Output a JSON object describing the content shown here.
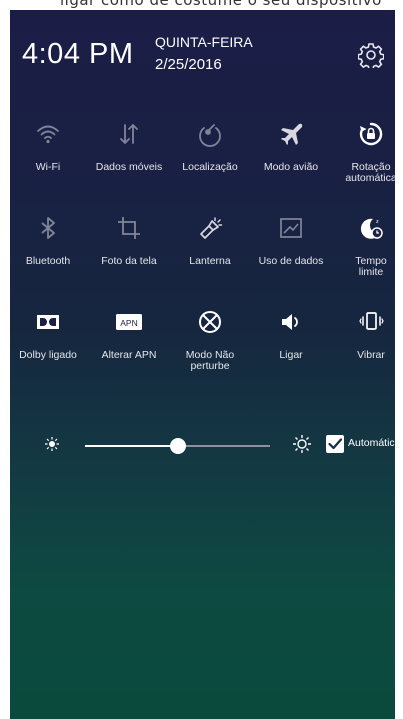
{
  "top_peek_text": "ligar como de costume o seu dispositivo",
  "status": {
    "time": "4:04 PM",
    "day": "QUINTA-FEIRA",
    "date": "2/25/2016"
  },
  "icons": {
    "settings": "gear-icon",
    "brightness_low": "sun-small-icon",
    "brightness_high": "sun-large-icon"
  },
  "tiles": [
    {
      "label": "Wi-Fi",
      "icon": "wifi-icon",
      "enabled": false
    },
    {
      "label": "Dados móveis",
      "icon": "mobile-data-icon",
      "enabled": false
    },
    {
      "label": "Localização",
      "icon": "location-icon",
      "enabled": false
    },
    {
      "label": "Modo avião",
      "icon": "airplane-icon",
      "enabled": false
    },
    {
      "label": "Rotação\nautomática",
      "icon": "rotation-lock-icon",
      "enabled": true
    },
    {
      "label": "Bluetooth",
      "icon": "bluetooth-icon",
      "enabled": false
    },
    {
      "label": "Foto da tela",
      "icon": "crop-icon",
      "enabled": false
    },
    {
      "label": "Lanterna",
      "icon": "flashlight-icon",
      "enabled": false
    },
    {
      "label": "Uso de dados",
      "icon": "data-usage-icon",
      "enabled": false
    },
    {
      "label": "Tempo\nlimite",
      "icon": "moon-timeout-icon",
      "enabled": true
    },
    {
      "label": "Dolby ligado",
      "icon": "dolby-icon",
      "enabled": true
    },
    {
      "label": "Alterar APN",
      "icon": "apn-icon",
      "icon_text": "APN",
      "enabled": true
    },
    {
      "label": "Modo Não\nperturbe",
      "icon": "do-not-disturb-icon",
      "enabled": true
    },
    {
      "label": "Ligar",
      "icon": "speaker-icon",
      "enabled": true
    },
    {
      "label": "Vibrar",
      "icon": "vibrate-icon",
      "enabled": true
    }
  ],
  "brightness": {
    "level": 0.5,
    "auto_checked": true,
    "auto_label": "Automático"
  }
}
